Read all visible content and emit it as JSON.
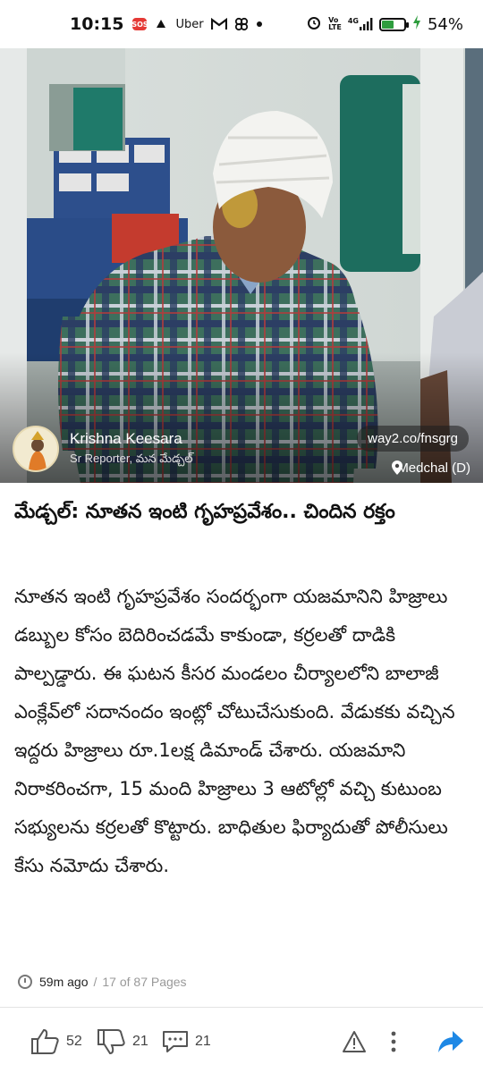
{
  "status_bar": {
    "time": "10:15",
    "apps": [
      "Uber"
    ],
    "network": "4G",
    "battery_level": 0.54,
    "battery_text": "54%"
  },
  "hero": {
    "reporter_name": "Krishna Keesara",
    "reporter_role": "Sr Reporter, మన మేడ్చల్",
    "short_link": "way2.co/fnsgrg",
    "location": "Medchal (D)"
  },
  "article": {
    "headline": "మేడ్చల్: నూతన ఇంటి గృహప్రవేశం.. చిందిన రక్తం",
    "body": "నూతన ఇంటి గృహప్రవేశం సందర్భంగా యజమానిని హిజ్రాలు డబ్బుల కోసం బెదిరించడమే కాకుండా, కర్రలతో దాడికి పాల్పడ్డారు. ఈ ఘటన కీసర మండలం  చీర్యాలలోని బాలాజీ ఎంక్లేవ్‌లో సదానందం ఇంట్లో చోటుచేసుకుంది. వేడుకకు వచ్చిన ఇద్దరు హిజ్రాలు రూ.1లక్ష డిమాండ్ చేశారు. యజమాని నిరాకరించగా, 15 మంది హిజ్రాలు 3 ఆటోల్లో వచ్చి కుటుంబ సభ్యులను కర్రలతో కొట్టారు. బాధితుల ఫిర్యాదుతో పోలీసులు కేసు నమోదు చేశారు.",
    "time_ago": "59m ago",
    "pages": "17 of 87 Pages"
  },
  "actions": {
    "likes": "52",
    "dislikes": "21",
    "comments": "21"
  },
  "colors": {
    "accent": "#1e88e5",
    "battery": "#2e9d3e",
    "sos": "#e53935"
  }
}
